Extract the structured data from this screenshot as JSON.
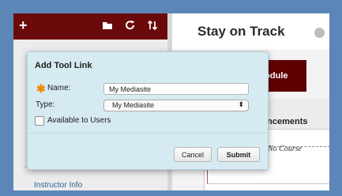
{
  "toolbar": {
    "add_label": "+",
    "icons": [
      "folder-icon",
      "refresh-icon",
      "sort-icon"
    ]
  },
  "sidebar": {
    "instructor_link": "Instructor Info"
  },
  "course": {
    "title": "Stay on Track",
    "tab_label": "Module",
    "announcements_title": "Announcements",
    "announcements_visible": "nouncements",
    "empty_text": "No Course"
  },
  "dialog": {
    "title": "Add Tool Link",
    "name_label": "Name:",
    "name_value": "My Mediasite",
    "type_label": "Type:",
    "type_value": "My Mediasite",
    "available_label": "Available to Users",
    "available_checked": false,
    "cancel_label": "Cancel",
    "submit_label": "Submit"
  },
  "colors": {
    "brand": "#6b0a0a",
    "required": "#f28a00",
    "dialog_bg": "#d6eaf1",
    "frame": "#5c86b8"
  }
}
